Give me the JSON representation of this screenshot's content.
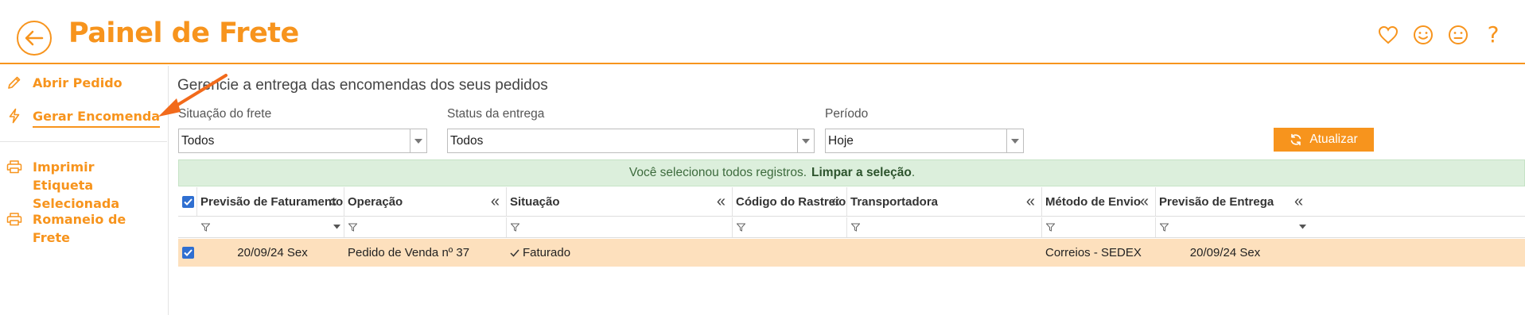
{
  "header": {
    "title": "Painel de Frete",
    "icons": [
      "back-arrow-icon",
      "heart-icon",
      "smile-icon",
      "neutral-face-icon",
      "help-icon"
    ],
    "help_glyph": "?"
  },
  "colors": {
    "accent": "#f7941d",
    "banner_bg": "#dcefdc",
    "row_selected": "#fde0bd",
    "checkbox": "#2f6fd1"
  },
  "sidebar": {
    "items": [
      {
        "label": "Abrir Pedido",
        "icon": "pencil-icon"
      },
      {
        "label": "Gerar Encomenda",
        "icon": "bolt-icon"
      },
      {
        "label": "Imprimir Etiqueta Selecionada",
        "icon": "printer-icon"
      },
      {
        "label": "Romaneio de Frete",
        "icon": "printer-icon"
      }
    ]
  },
  "main": {
    "subtitle": "Gerencie a entrega das encomendas dos seus pedidos",
    "filters": {
      "situacao": {
        "label": "Situação do frete",
        "value": "Todos"
      },
      "status": {
        "label": "Status da entrega",
        "value": "Todos"
      },
      "periodo": {
        "label": "Período",
        "value": "Hoje"
      }
    },
    "refresh_label": "Atualizar",
    "banner": {
      "text": "Você selecionou todos registros.",
      "link": "Limpar a seleção",
      "suffix": "."
    }
  },
  "grid": {
    "columns": [
      "Previsão de Faturamento",
      "Operação",
      "Situação",
      "Código do Rastreio",
      "Transportadora",
      "Método de Envio",
      "Previsão de Entrega"
    ],
    "rows": [
      {
        "checked": true,
        "previsao_faturamento": "20/09/24 Sex",
        "operacao": "Pedido de Venda nº 37",
        "situacao": "Faturado",
        "codigo_rastreio": "",
        "transportadora": "",
        "metodo_envio": "Correios - SEDEX",
        "previsao_entrega": "20/09/24 Sex"
      }
    ]
  }
}
